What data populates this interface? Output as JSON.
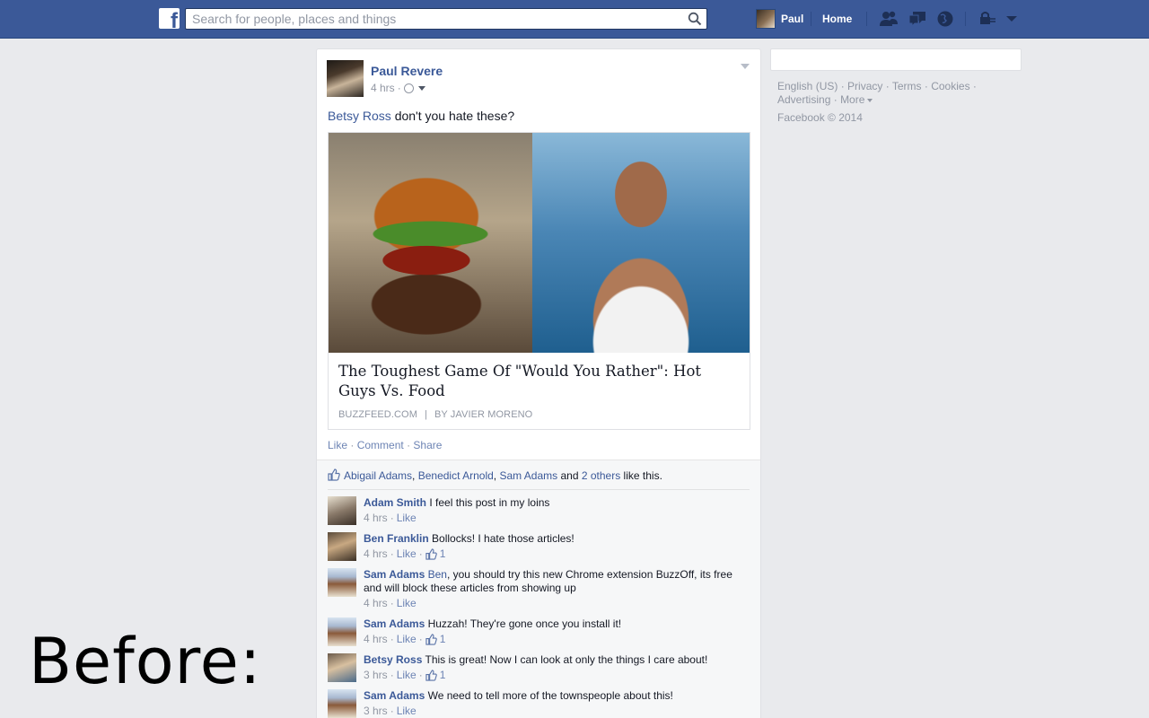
{
  "topbar": {
    "search_placeholder": "Search for people, places and things",
    "user_name": "Paul",
    "home_label": "Home"
  },
  "post": {
    "author": "Paul Revere",
    "time": "4 hrs",
    "tagged": "Betsy Ross",
    "text": " don't you hate these?",
    "share": {
      "title": "The Toughest Game Of \"Would You Rather\": Hot Guys Vs. Food",
      "source": "BUZZFEED.COM",
      "byline": "BY JAVIER MORENO"
    },
    "actions": {
      "like": "Like",
      "comment": "Comment",
      "share": "Share",
      "sep": "·"
    },
    "likes": {
      "people": [
        "Abigail Adams",
        "Benedict Arnold",
        "Sam Adams"
      ],
      "others": "2 others",
      "and": " and ",
      "suffix": " like this."
    },
    "comments": [
      {
        "name": "Adam Smith",
        "text": " I feel this post in my loins",
        "time": "4 hrs",
        "like": "Like",
        "count": ""
      },
      {
        "name": "Ben Franklin",
        "text": " Bollocks! I hate those articles!",
        "time": "4 hrs",
        "like": "Like",
        "count": "1"
      },
      {
        "name": "Sam Adams",
        "mention": " Ben",
        "text": ", you should try this new Chrome extension BuzzOff, its free and will block these articles from showing up",
        "time": "4 hrs",
        "like": "Like",
        "count": ""
      },
      {
        "name": "Sam Adams",
        "text": " Huzzah! They're gone once you install it!",
        "time": "4 hrs",
        "like": "Like",
        "count": "1"
      },
      {
        "name": "Betsy Ross",
        "text": " This is great! Now I can look at only the things I care about!",
        "time": "3 hrs",
        "like": "Like",
        "count": "1"
      },
      {
        "name": "Sam Adams",
        "text": " We need to tell more of the townspeople about this!",
        "time": "3 hrs",
        "like": "Like",
        "count": ""
      }
    ]
  },
  "footer": {
    "links": [
      "English (US)",
      "Privacy",
      "Terms",
      "Cookies",
      "Advertising",
      "More"
    ],
    "copyright": "Facebook © 2014"
  },
  "overlay": {
    "label": "Before:"
  },
  "colors": {
    "brand": "#3b5998",
    "link": "#3b5998",
    "muted": "#9197a3",
    "background": "#e9eaed"
  }
}
